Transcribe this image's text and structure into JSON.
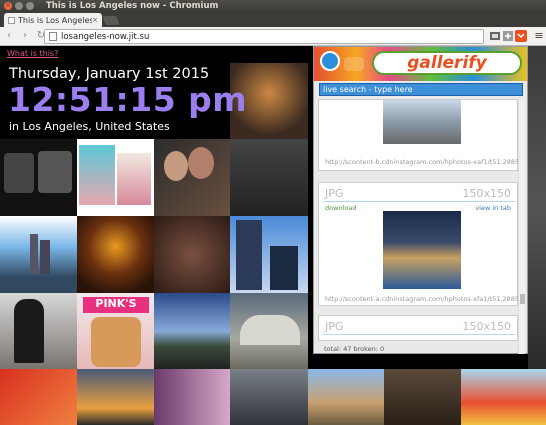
{
  "window": {
    "title": "This is Los Angeles now - Chromium"
  },
  "tab": {
    "label": "This is Los Angeles n",
    "close": "×"
  },
  "toolbar": {
    "url": "losangeles-now.jit.su",
    "back": "‹",
    "forward": "›",
    "reload": "↻",
    "menu": "≡"
  },
  "page": {
    "what_link": "What is this?",
    "date": "Thursday, January 1st 2015",
    "time": "12:51:15 pm",
    "location": "in Los Angeles, United States"
  },
  "gallerify": {
    "logo": "gallerify",
    "search_placeholder": "live search - type here",
    "cards": [
      {
        "type": "",
        "dims": "",
        "url": "http://scontent-b.cdninstagram.com/hphotos-xaf1/t51.2885..."
      },
      {
        "type": "JPG",
        "dims": "150x150",
        "download": "download",
        "view": "view in tab",
        "url": "http://scontent-a.cdninstagram.com/hphotos-xfa1/t51.2885..."
      },
      {
        "type": "JPG",
        "dims": "150x150"
      }
    ],
    "status": "total: 47    broken: 0"
  },
  "colors": {
    "time": "#9b7ef0",
    "link": "#e0568a",
    "accent": "#3d8fd8"
  }
}
